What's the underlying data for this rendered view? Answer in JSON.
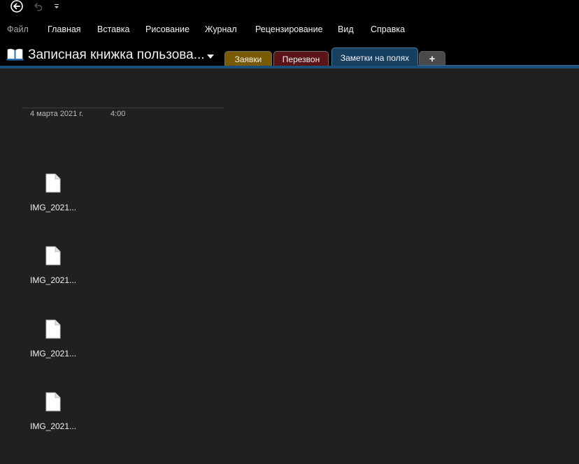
{
  "quick_access": {
    "back_icon": "back-arrow-icon",
    "undo_icon": "undo-icon",
    "customize_icon": "customize-dropdown-icon"
  },
  "ribbon": {
    "tabs": [
      {
        "label": "Файл"
      },
      {
        "label": "Главная"
      },
      {
        "label": "Вставка"
      },
      {
        "label": "Рисование"
      },
      {
        "label": "Журнал"
      },
      {
        "label": "Рецензирование"
      },
      {
        "label": "Вид"
      },
      {
        "label": "Справка"
      }
    ]
  },
  "notebook": {
    "icon": "notebook-icon",
    "title": "Записная книжка пользова...",
    "sections": [
      {
        "label": "Заявки",
        "color": "#7a5a00"
      },
      {
        "label": "Перезвон",
        "color": "#5a1418"
      },
      {
        "label": "Заметки на полях",
        "color": "#163f60",
        "active": true
      }
    ],
    "add_section_label": "+"
  },
  "page": {
    "date": "4 марта 2021 г.",
    "time": "4:00",
    "attachments": [
      {
        "name": "IMG_2021...",
        "icon": "file-icon"
      },
      {
        "name": "IMG_2021...",
        "icon": "file-icon"
      },
      {
        "name": "IMG_2021...",
        "icon": "file-icon"
      },
      {
        "name": "IMG_2021...",
        "icon": "file-icon"
      }
    ]
  },
  "colors": {
    "background": "#202020",
    "chrome": "#000000",
    "accent": "#1d4f78"
  }
}
